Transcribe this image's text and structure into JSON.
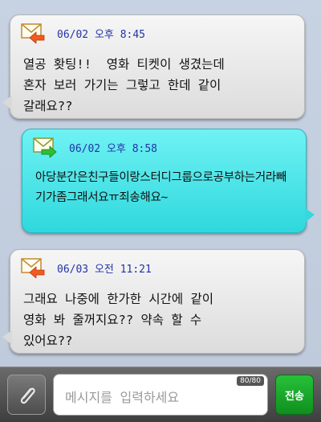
{
  "messages": [
    {
      "direction": "received",
      "time": "06/02 오후 8:45",
      "icon": "envelope-arrow-left-icon",
      "text": "열공 홧팅!!  영화 티켓이 생겼는데\n혼자 보러 가기는 그렇고 한데 같이\n갈래요??"
    },
    {
      "direction": "sent",
      "time": "06/02 오후 8:58",
      "icon": "envelope-arrow-right-icon",
      "text": "아당분간은친구들이랑스터디그룹으로공부하는거라빼기가좀그래서요ㅠ죄송해요~"
    },
    {
      "direction": "received",
      "time": "06/03 오전 11:21",
      "icon": "envelope-arrow-left-icon",
      "text": "그래요 나중에 한가한 시간에 같이\n영화 봐 줄꺼지요?? 약속 할 수\n있어요??"
    }
  ],
  "composer": {
    "attach_icon": "paperclip-icon",
    "placeholder": "메시지를 입력하세요",
    "counter": "80/80",
    "send_label": "전송"
  },
  "colors": {
    "received_bubble": "#e6e6e6",
    "sent_bubble": "#45e3e7",
    "time_text": "#2233a8",
    "send_button": "#1aa82c"
  }
}
